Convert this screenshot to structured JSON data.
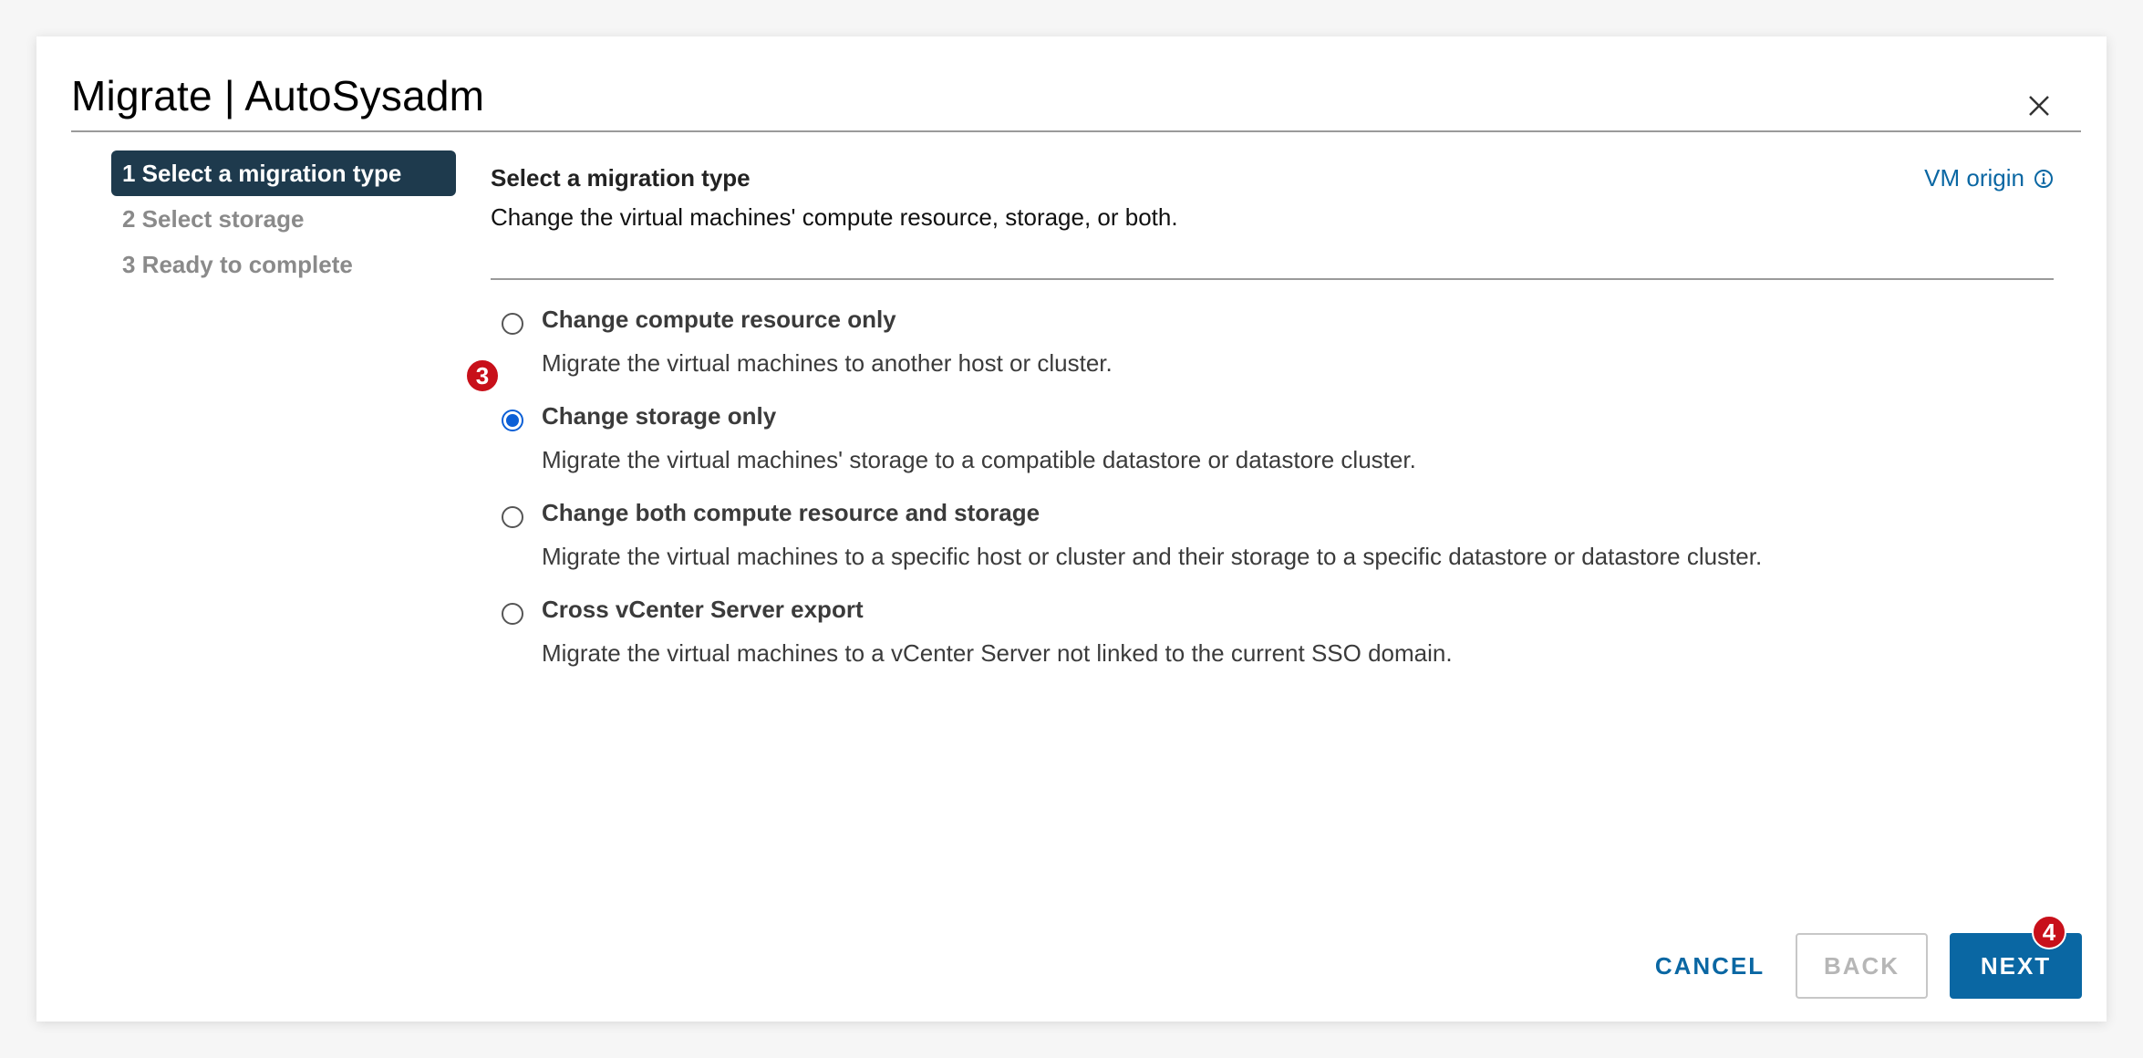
{
  "dialog": {
    "title": "Migrate | AutoSysadm",
    "close_icon": "close-icon"
  },
  "steps": [
    {
      "label": "1 Select a migration type",
      "active": true
    },
    {
      "label": "2 Select storage",
      "active": false
    },
    {
      "label": "3 Ready to complete",
      "active": false
    }
  ],
  "main": {
    "heading": "Select a migration type",
    "description": "Change the virtual machines' compute resource, storage, or both.",
    "vm_origin_label": "VM origin",
    "vm_origin_icon": "info-icon"
  },
  "options": [
    {
      "label": "Change compute resource only",
      "description": "Migrate the virtual machines to another host or cluster.",
      "selected": false
    },
    {
      "label": "Change storage only",
      "description": "Migrate the virtual machines' storage to a compatible datastore or datastore cluster.",
      "selected": true
    },
    {
      "label": "Change both compute resource and storage",
      "description": "Migrate the virtual machines to a specific host or cluster and their storage to a specific datastore or datastore cluster.",
      "selected": false
    },
    {
      "label": "Cross vCenter Server export",
      "description": "Migrate the virtual machines to a vCenter Server not linked to the current SSO domain.",
      "selected": false
    }
  ],
  "badges": {
    "step_marker_a": "3",
    "step_marker_b": "4"
  },
  "footer": {
    "cancel_label": "CANCEL",
    "back_label": "BACK",
    "next_label": "NEXT"
  },
  "colors": {
    "accent": "#0a67a3",
    "active_step_bg": "#1e3a4d",
    "radio_selected": "#0b5fd6",
    "badge": "#c8101a"
  }
}
